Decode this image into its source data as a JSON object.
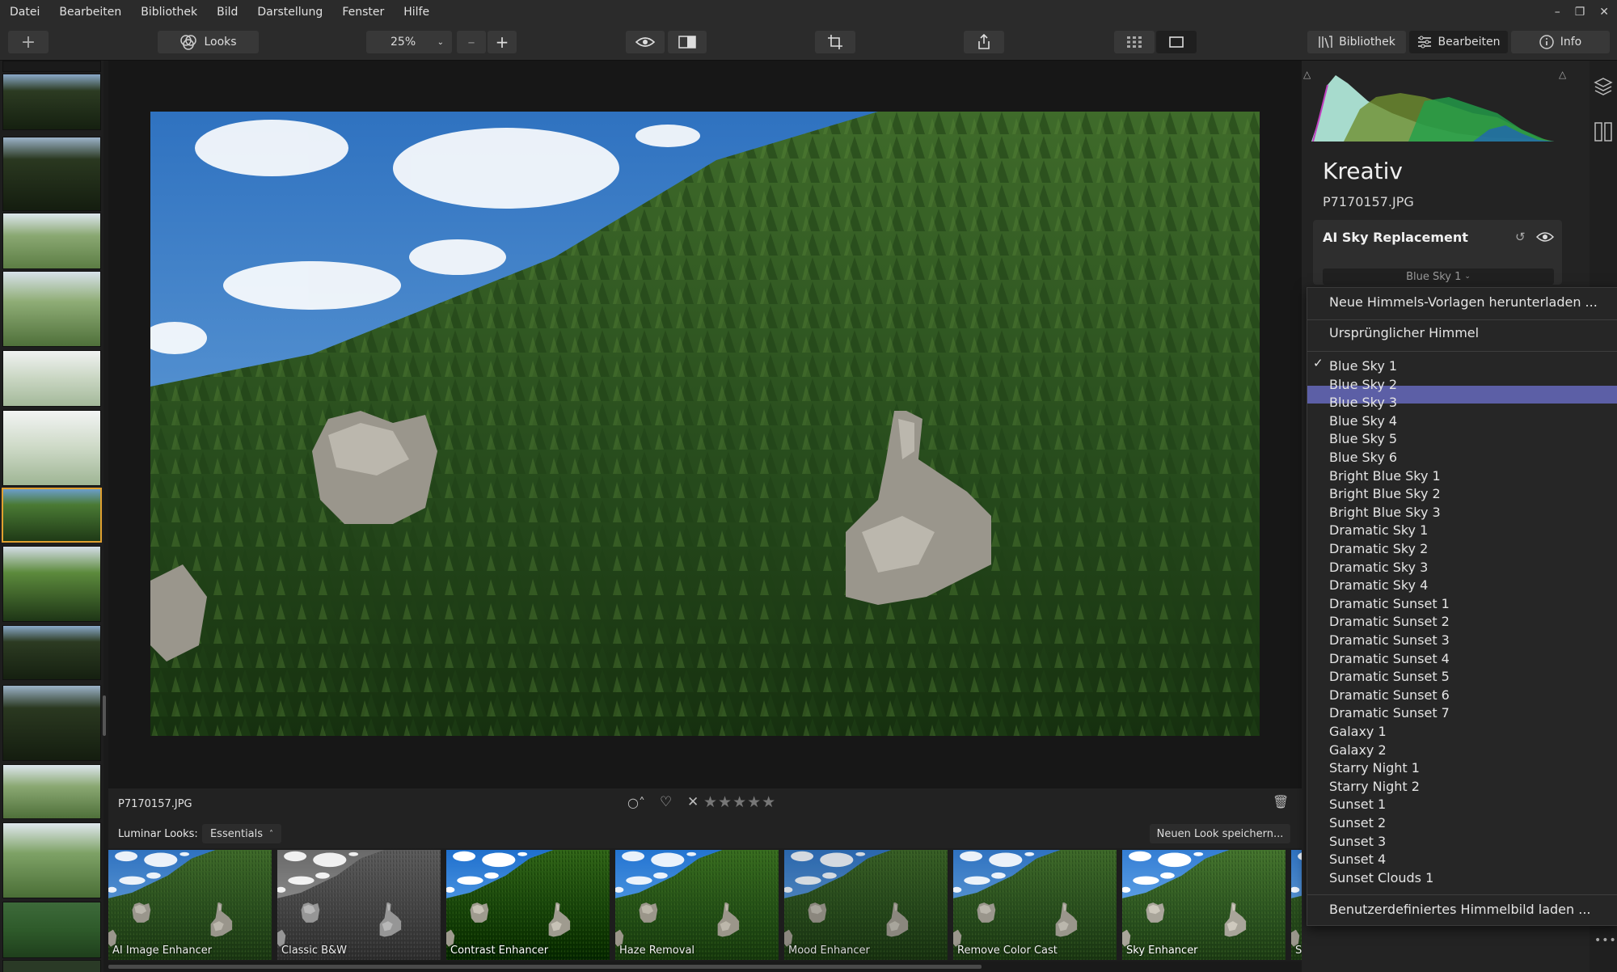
{
  "menu": [
    "Datei",
    "Bearbeiten",
    "Bibliothek",
    "Bild",
    "Darstellung",
    "Fenster",
    "Hilfe"
  ],
  "toolbar": {
    "looks_label": "Looks",
    "zoom_value": "25%",
    "library_label": "Bibliothek",
    "edit_label": "Bearbeiten",
    "info_label": "Info"
  },
  "panel": {
    "section_title": "Kreativ",
    "filename": "P7170157.JPG",
    "tool_title": "AI Sky Replacement",
    "sky_select_value": "Blue Sky 1"
  },
  "dropdown": {
    "download_label": "Neue Himmels-Vorlagen herunterladen ...",
    "original_label": "Ursprünglicher Himmel",
    "checked_item": "Blue Sky 1",
    "highlighted_item": "Blue Sky 3",
    "items": [
      "Blue Sky 1",
      "Blue Sky 2",
      "Blue Sky 3",
      "Blue Sky 4",
      "Blue Sky 5",
      "Blue Sky 6",
      "Bright Blue Sky 1",
      "Bright Blue Sky 2",
      "Bright Blue Sky 3",
      "Dramatic Sky 1",
      "Dramatic Sky 2",
      "Dramatic Sky 3",
      "Dramatic Sky 4",
      "Dramatic Sunset 1",
      "Dramatic Sunset 2",
      "Dramatic Sunset 3",
      "Dramatic Sunset 4",
      "Dramatic Sunset 5",
      "Dramatic Sunset 6",
      "Dramatic Sunset 7",
      "Galaxy 1",
      "Galaxy 2",
      "Starry Night 1",
      "Starry Night 2",
      "Sunset 1",
      "Sunset 2",
      "Sunset 3",
      "Sunset 4",
      "Sunset Clouds 1"
    ],
    "custom_label": "Benutzerdefiniertes Himmelbild laden ..."
  },
  "infobar": {
    "filename": "P7170157.JPG"
  },
  "looks": {
    "label": "Luminar Looks:",
    "category": "Essentials",
    "save_label": "Neuen Look speichern...",
    "items": [
      "AI Image Enhancer",
      "Classic B&W",
      "Contrast Enhancer",
      "Haze Removal",
      "Mood Enhancer",
      "Remove Color Cast",
      "Sky Enhancer",
      "Sc"
    ]
  },
  "colors": {
    "accent_highlight": "#5c5fa6",
    "selected_thumb": "#e0a030"
  }
}
